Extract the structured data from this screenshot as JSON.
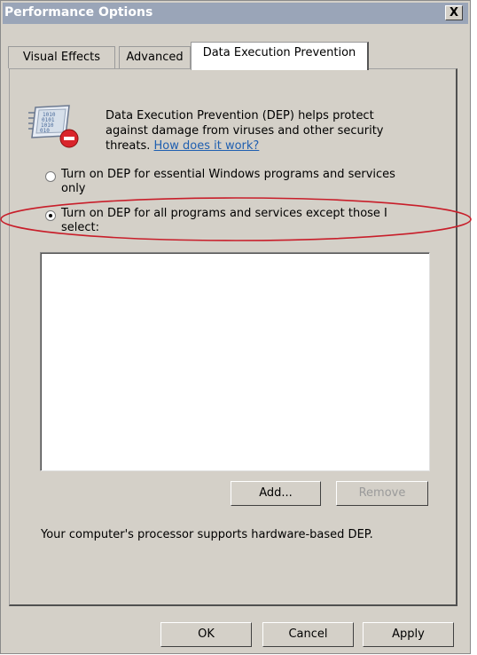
{
  "window": {
    "title": "Performance Options",
    "close_label": "X"
  },
  "tabs": [
    {
      "label": "Visual Effects",
      "active": false
    },
    {
      "label": "Advanced",
      "active": false
    },
    {
      "label": "Data Execution Prevention",
      "active": true
    }
  ],
  "dep": {
    "intro_text": "Data Execution Prevention (DEP) helps protect against damage from viruses and other security threats.",
    "help_link": "How does it work?",
    "option_essential_line1": "Turn on DEP for essential Windows programs and services",
    "option_essential_line2": "only",
    "option_all_line1": "Turn on DEP for all programs and services except those I",
    "option_all_line2": "select:",
    "selected_option": "all",
    "add_button": "Add...",
    "remove_button": "Remove",
    "hardware_note": "Your computer's processor supports hardware-based DEP."
  },
  "footer": {
    "ok": "OK",
    "cancel": "Cancel",
    "apply": "Apply"
  },
  "colors": {
    "titlebar": "#9aa5b8",
    "window_bg": "#d4d0c8",
    "link": "#1f5fb0",
    "annotation": "#c81e2a"
  }
}
